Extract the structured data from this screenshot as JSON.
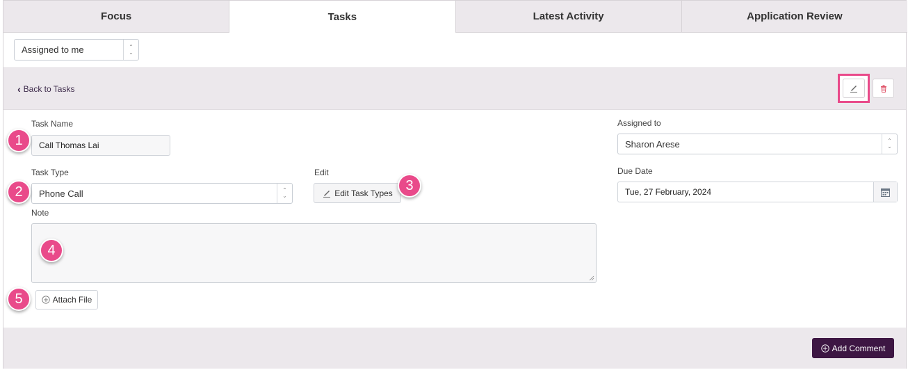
{
  "tabs": [
    {
      "label": "Focus",
      "active": false
    },
    {
      "label": "Tasks",
      "active": true
    },
    {
      "label": "Latest Activity",
      "active": false
    },
    {
      "label": "Application Review",
      "active": false
    }
  ],
  "filter": {
    "value": "Assigned to me"
  },
  "toolbar": {
    "back_label": "Back to Tasks",
    "edit_icon": "pencil-icon",
    "delete_icon": "trash-icon"
  },
  "form": {
    "task_name_label": "Task Name",
    "task_name_value": "Call Thomas Lai",
    "task_type_label": "Task Type",
    "task_type_value": "Phone Call",
    "edit_label": "Edit",
    "edit_task_types_button": "Edit Task Types",
    "note_label": "Note",
    "note_value": "",
    "attach_file_button": "Attach File",
    "assigned_to_label": "Assigned to",
    "assigned_to_value": "Sharon Arese",
    "due_date_label": "Due Date",
    "due_date_value": "Tue, 27 February, 2024"
  },
  "footer": {
    "add_comment_button": "Add Comment"
  },
  "callouts": [
    "1",
    "2",
    "3",
    "4",
    "5"
  ],
  "colors": {
    "accent": "#e94a8a",
    "primary_button": "#3d1643",
    "panel_bg": "#ece8ec"
  }
}
